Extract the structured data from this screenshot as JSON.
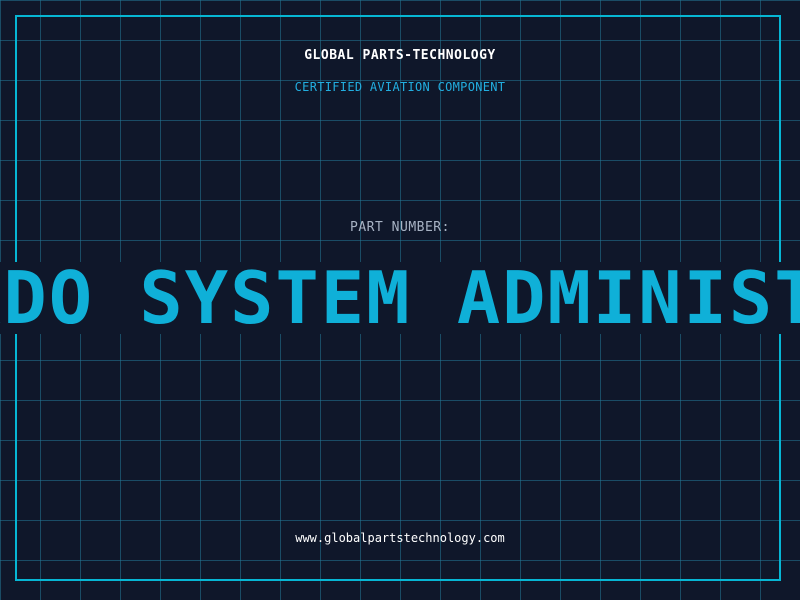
{
  "header": {
    "brand": "GLOBAL PARTS-TECHNOLOGY",
    "subtitle": "CERTIFIED AVIATION COMPONENT"
  },
  "part": {
    "label": "PART NUMBER:",
    "value": "ADO SYSTEM ADMINISTRATOR"
  },
  "footer": {
    "url": "www.globalpartstechnology.com"
  },
  "colors": {
    "background": "#0f172a",
    "grid": "#227896",
    "accent": "#06b6d4",
    "part_number": "#0fb0d8",
    "label": "#a8b3c4"
  }
}
